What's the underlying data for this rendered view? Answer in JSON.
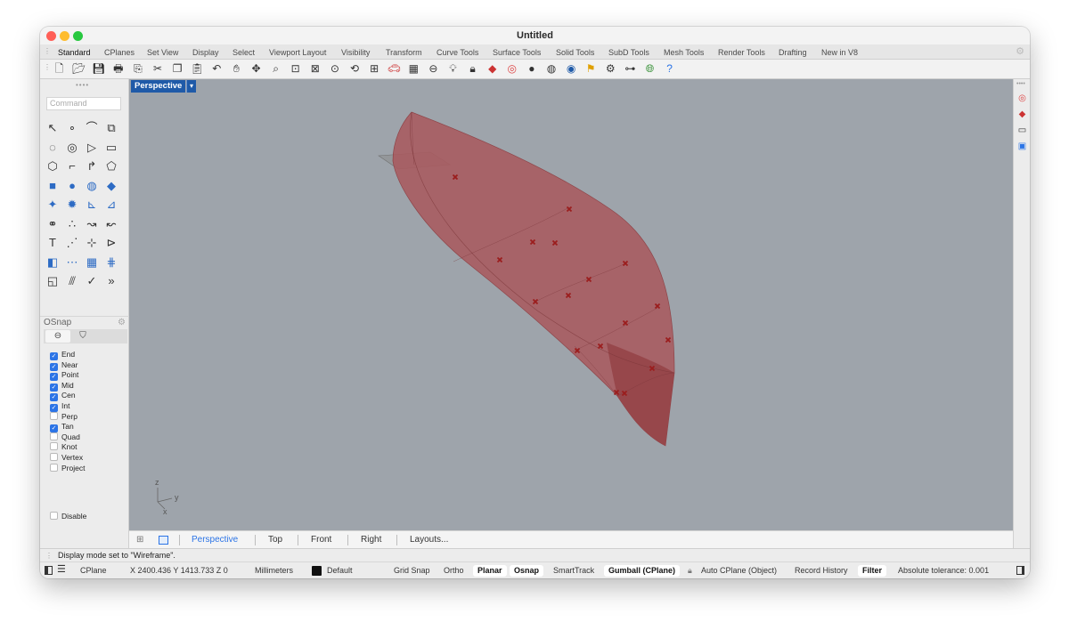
{
  "window": {
    "title": "Untitled",
    "traffic_colors": [
      "#ff5f57",
      "#febc2e",
      "#28c840"
    ]
  },
  "tabs": [
    {
      "label": "Standard",
      "active": true
    },
    {
      "label": "CPlanes"
    },
    {
      "label": "Set View"
    },
    {
      "label": "Display"
    },
    {
      "label": "Select"
    },
    {
      "label": "Viewport Layout"
    },
    {
      "label": "Visibility"
    },
    {
      "label": "Transform"
    },
    {
      "label": "Curve Tools"
    },
    {
      "label": "Surface Tools"
    },
    {
      "label": "Solid Tools"
    },
    {
      "label": "SubD Tools"
    },
    {
      "label": "Mesh Tools"
    },
    {
      "label": "Render Tools"
    },
    {
      "label": "Drafting"
    },
    {
      "label": "New in V8"
    }
  ],
  "toolbar_icons": [
    "new-icon",
    "open-icon",
    "save-icon",
    "print-icon",
    "import-icon",
    "cut-icon",
    "copy-icon",
    "paste-icon",
    "undo-icon",
    "pan-icon",
    "rotate-view-icon",
    "zoom-icon",
    "zoom-window-icon",
    "zoom-extents-icon",
    "zoom-selected-icon",
    "rotate-icon",
    "four-viewports-icon",
    "car-icon",
    "grid-icon",
    "cplane-icon",
    "light-icon",
    "lock-icon",
    "layer-icon",
    "color-wheel-icon",
    "sphere-shaded-icon",
    "sphere-wire-icon",
    "render-sphere-icon",
    "flag-icon",
    "gear-icon",
    "hierarchy-icon",
    "globe-icon",
    "help-icon"
  ],
  "command": {
    "placeholder": "Command"
  },
  "osnap": {
    "title": "OSnap",
    "items": [
      {
        "label": "End",
        "checked": true
      },
      {
        "label": "Near",
        "checked": true
      },
      {
        "label": "Point",
        "checked": true
      },
      {
        "label": "Mid",
        "checked": true
      },
      {
        "label": "Cen",
        "checked": true
      },
      {
        "label": "Int",
        "checked": true
      },
      {
        "label": "Perp",
        "checked": false
      },
      {
        "label": "Tan",
        "checked": true
      },
      {
        "label": "Quad",
        "checked": false
      },
      {
        "label": "Knot",
        "checked": false
      },
      {
        "label": "Vertex",
        "checked": false
      },
      {
        "label": "Project",
        "checked": false
      }
    ],
    "disable": {
      "label": "Disable",
      "checked": false
    }
  },
  "viewport": {
    "name": "Perspective",
    "axis": {
      "z": "z",
      "y": "y",
      "x": "x"
    },
    "colors": {
      "background": "#9ea4ab",
      "hull": "#a85a5e",
      "point": "#9b1d1d"
    }
  },
  "view_tabs": [
    {
      "label": "Perspective",
      "active": true
    },
    {
      "label": "Top"
    },
    {
      "label": "Front"
    },
    {
      "label": "Right"
    },
    {
      "label": "Layouts..."
    }
  ],
  "command_history": "Display mode set to \"Wireframe\".",
  "status": {
    "cplane": "CPlane",
    "coords": "X 2400.436 Y 1413.733 Z 0",
    "units": "Millimeters",
    "layer": "Default",
    "items": [
      {
        "label": "Grid Snap",
        "active": false
      },
      {
        "label": "Ortho",
        "active": false
      },
      {
        "label": "Planar",
        "active": true
      },
      {
        "label": "Osnap",
        "active": true
      },
      {
        "label": "SmartTrack",
        "active": false
      },
      {
        "label": "Gumball (CPlane)",
        "active": true
      },
      {
        "label": "Auto CPlane (Object)",
        "active": false
      },
      {
        "label": "Record History",
        "active": false
      },
      {
        "label": "Filter",
        "active": true
      }
    ],
    "tolerance": "Absolute tolerance: 0.001"
  }
}
